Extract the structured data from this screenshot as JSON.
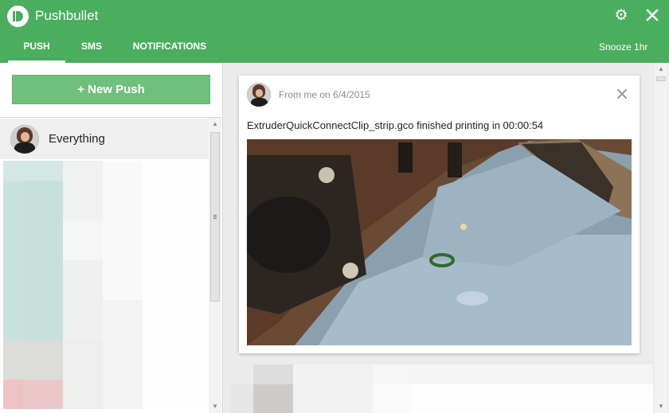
{
  "app": {
    "title": "Pushbullet",
    "logo_icon": "pushbullet-logo-icon",
    "accent": "#4bae5e"
  },
  "header": {
    "tabs": [
      {
        "label": "PUSH",
        "active": true
      },
      {
        "label": "SMS",
        "active": false
      },
      {
        "label": "NOTIFICATIONS",
        "active": false
      }
    ],
    "snooze_label": "Snooze 1hr",
    "settings_icon": "gear-icon",
    "close_icon": "close-icon"
  },
  "sidebar": {
    "new_push_label": "+ New Push",
    "items": [
      {
        "label": "Everything",
        "icon": "avatar"
      }
    ]
  },
  "push": {
    "meta": "From me on 6/4/2015",
    "message": "ExtruderQuickConnectClip_strip.gco finished printing in 00:00:54",
    "dismiss_icon": "close-icon",
    "image_subject": "3d-printer-bed-photo"
  }
}
